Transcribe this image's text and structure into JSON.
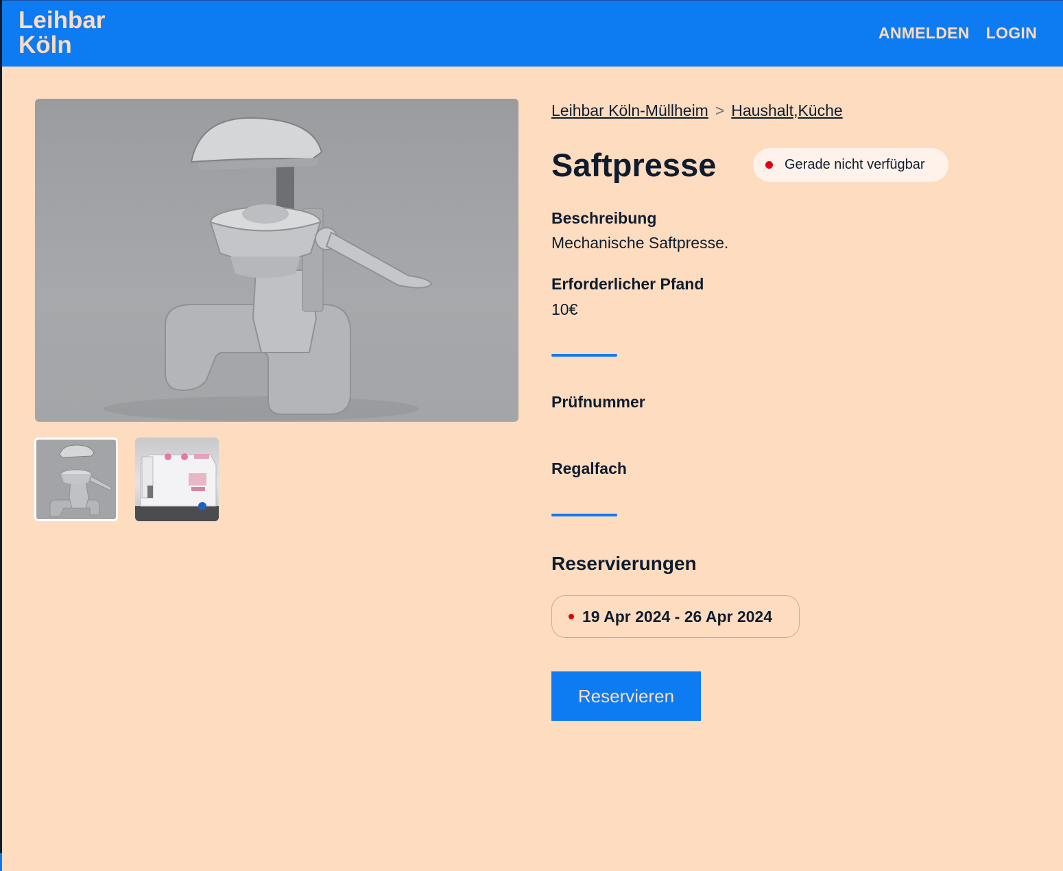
{
  "header": {
    "logo_line1": "Leihbar",
    "logo_line2": "Köln",
    "nav": [
      "ANMELDEN",
      "LOGIN"
    ]
  },
  "breadcrumb": {
    "location": "Leihbar Köln-Müllheim",
    "separator": ">",
    "category1": "Haushalt",
    "comma": ",",
    "category2": "Küche"
  },
  "item": {
    "title": "Saftpresse",
    "status": "Gerade nicht verfügbar",
    "description_label": "Beschreibung",
    "description": "Mechanische Saftpresse.",
    "deposit_label": "Erforderlicher Pfand",
    "deposit": "10€",
    "test_number_label": "Prüfnummer",
    "shelf_label": "Regalfach"
  },
  "reservations": {
    "heading": "Reservierungen",
    "items": [
      "19 Apr 2024 - 26 Apr 2024"
    ]
  },
  "actions": {
    "reserve_label": "Reservieren"
  },
  "images": {
    "main": "juicer-photo",
    "thumbnails": [
      "juicer-thumbnail",
      "sewing-machine-thumbnail"
    ]
  },
  "colors": {
    "brand": "#0d7bf2",
    "background": "#fedcc0",
    "status_unavailable": "#e0000f"
  }
}
